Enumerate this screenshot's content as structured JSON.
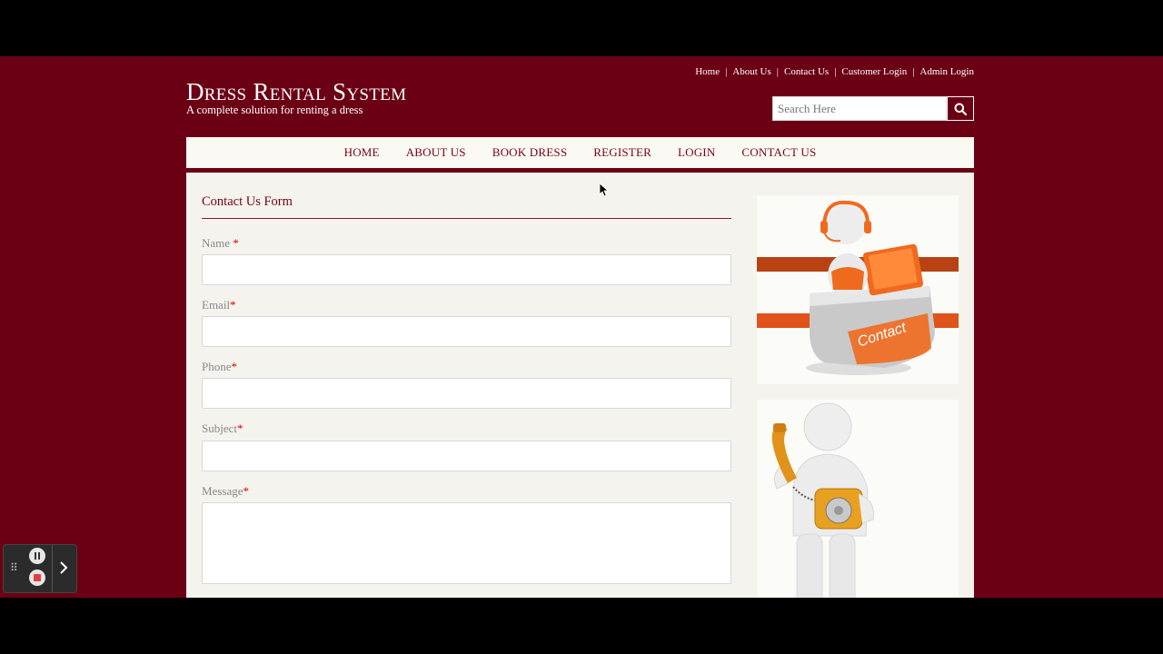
{
  "header": {
    "title": "Dress Rental System",
    "subtitle": "A complete solution for renting a dress"
  },
  "top_links": [
    "Home",
    "About Us",
    "Contact Us",
    "Customer Login",
    "Admin Login"
  ],
  "search": {
    "placeholder": "Search Here"
  },
  "nav": [
    "HOME",
    "ABOUT US",
    "BOOK DRESS",
    "REGISTER",
    "LOGIN",
    "CONTACT US"
  ],
  "form": {
    "title": "Contact Us Form",
    "required_mark": "*",
    "fields": [
      {
        "label": "Name ",
        "value": ""
      },
      {
        "label": "Email",
        "value": ""
      },
      {
        "label": "Phone",
        "value": ""
      },
      {
        "label": "Subject",
        "value": ""
      },
      {
        "label": "Message",
        "value": ""
      }
    ]
  },
  "images": {
    "contact_desk_text": "Contact"
  },
  "colors": {
    "brand": "#6b0014",
    "nav_text": "#7a0016",
    "panel": "#f4f3ee"
  }
}
